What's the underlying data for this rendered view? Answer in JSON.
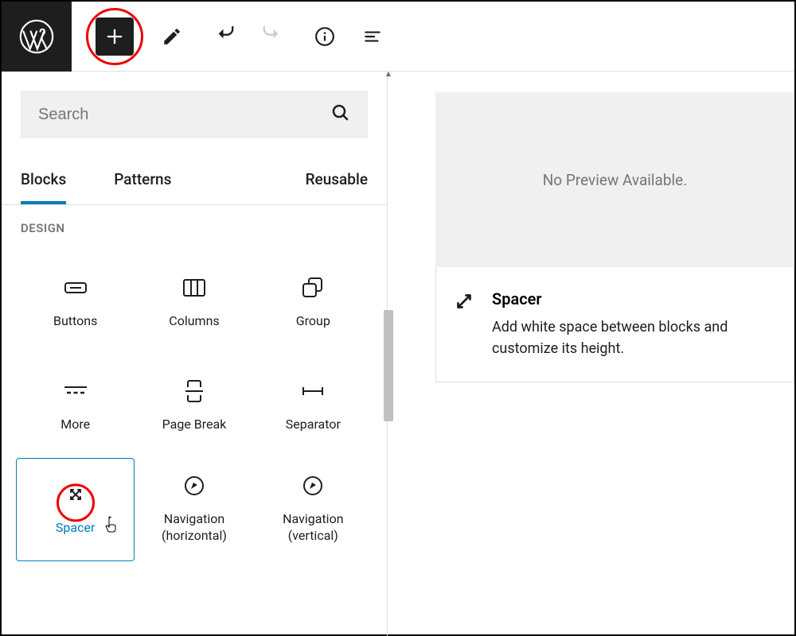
{
  "search": {
    "placeholder": "Search"
  },
  "tabs": [
    {
      "label": "Blocks"
    },
    {
      "label": "Patterns"
    },
    {
      "label": "Reusable"
    }
  ],
  "section_title": "DESIGN",
  "blocks": [
    {
      "label": "Buttons"
    },
    {
      "label": "Columns"
    },
    {
      "label": "Group"
    },
    {
      "label": "More"
    },
    {
      "label": "Page Break"
    },
    {
      "label": "Separator"
    },
    {
      "label": "Spacer"
    },
    {
      "label": "Navigation (horizontal)"
    },
    {
      "label": "Navigation (vertical)"
    }
  ],
  "preview": {
    "placeholder": "No Preview Available.",
    "title": "Spacer",
    "description": "Add white space between blocks and customize its height."
  }
}
